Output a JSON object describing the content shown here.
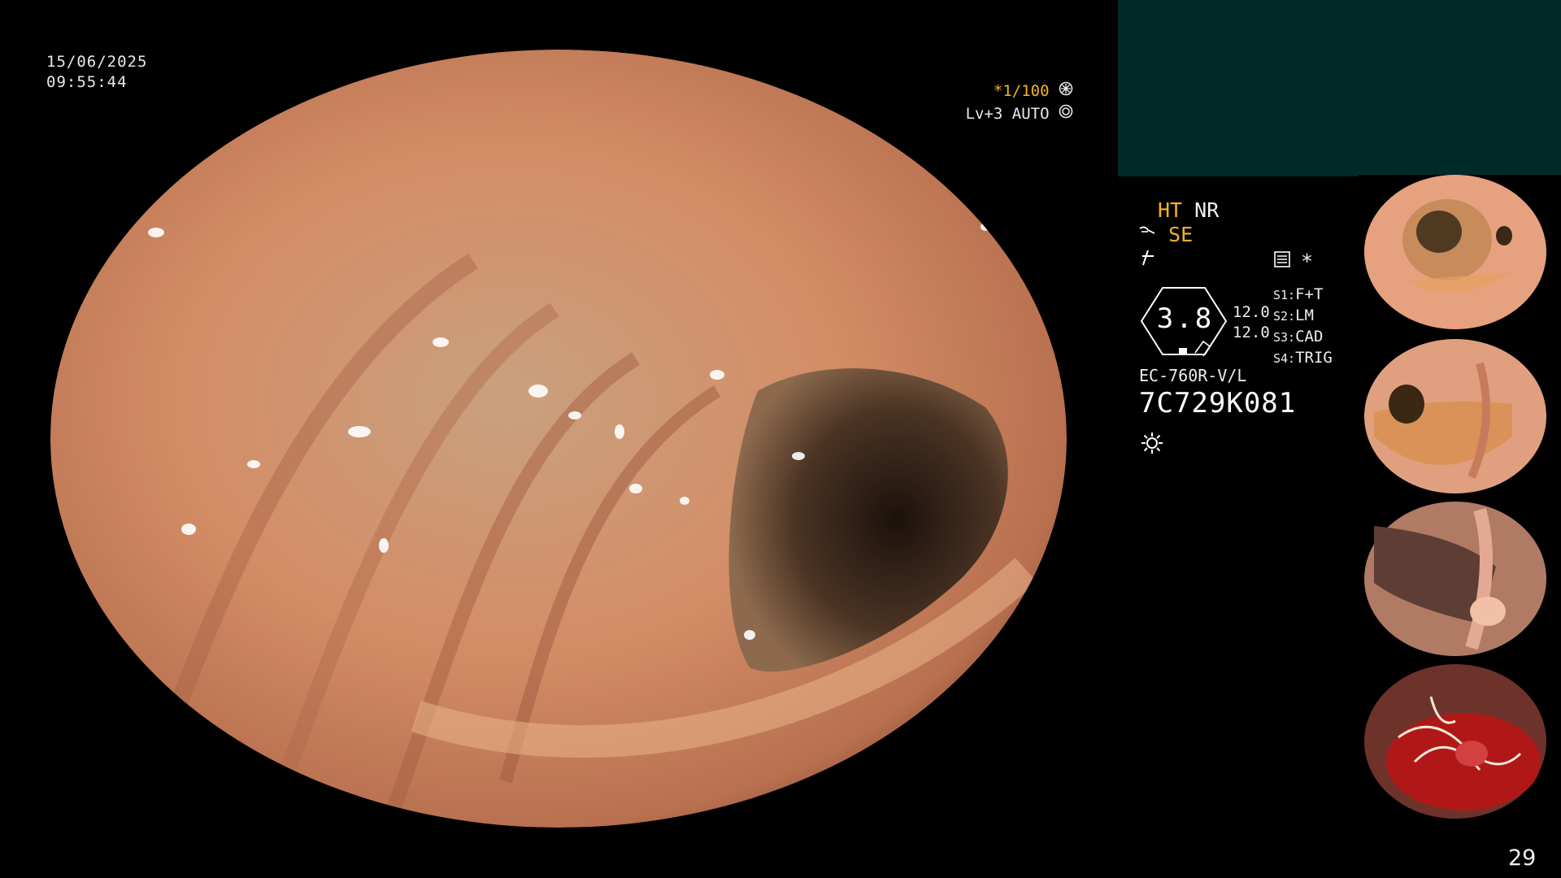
{
  "header": {
    "date": "15/06/2025",
    "time": "09:55:44"
  },
  "overlay": {
    "shutter": "*1/100",
    "level": "Lv+3 AUTO"
  },
  "status": {
    "ht": "HT",
    "nr": "NR",
    "se": "SE",
    "asterisk": "*"
  },
  "gauge": {
    "value": "3.8",
    "top_value": "12.0",
    "bottom_value": "12.0"
  },
  "settings": [
    {
      "key": "S1:",
      "value": "F+T"
    },
    {
      "key": "S2:",
      "value": "LM"
    },
    {
      "key": "S3:",
      "value": "CAD"
    },
    {
      "key": "S4:",
      "value": "TRIG"
    }
  ],
  "scope": {
    "model": "EC-760R-V/L",
    "serial": "7C729K081"
  },
  "icons": [
    "shutter-icon",
    "auto-icon",
    "scope-bend-icon",
    "filter-icon",
    "settings-doc-icon",
    "light-icon"
  ],
  "thumbnails": {
    "count": 4
  },
  "page": {
    "number": "29"
  },
  "colors": {
    "accent_yellow": "#f5b324",
    "panel_teal": "#002a28",
    "mucosa": "#d9926a"
  }
}
